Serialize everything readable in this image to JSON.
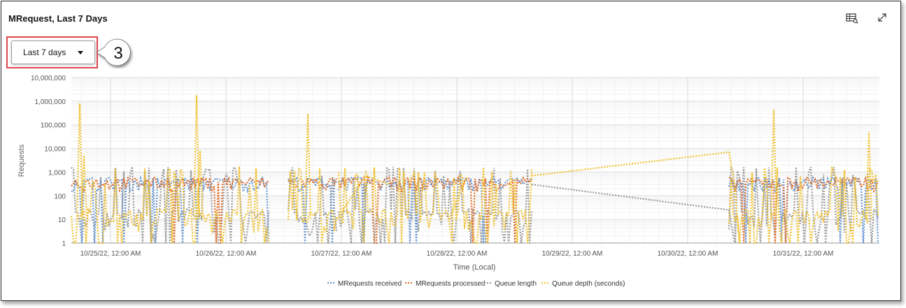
{
  "panel": {
    "title": "MRequest, Last 7 Days",
    "icons": {
      "table_view": "table-view-icon",
      "expand": "expand-icon"
    }
  },
  "range_select": {
    "value": "Last 7 days",
    "callout_number": "3"
  },
  "colors": {
    "received": "#6c98d2",
    "processed": "#e2702f",
    "queue_length": "#9b9b9b",
    "queue_depth": "#f1c232",
    "highlight": "#e0474c"
  },
  "chart_data": {
    "type": "line",
    "ylabel": "Requests",
    "xlabel": "Time (Local)",
    "y_scale": "log",
    "ylim": [
      1,
      10000000
    ],
    "y_ticks": [
      "1",
      "10",
      "100",
      "1,000",
      "10,000",
      "100,000",
      "1,000,000",
      "10,000,000"
    ],
    "x_ticks": [
      "10/25/22, 12:00 AM",
      "10/26/22, 12:00 AM",
      "10/27/22, 12:00 AM",
      "10/28/22, 12:00 AM",
      "10/29/22, 12:00 AM",
      "10/30/22, 12:00 AM",
      "10/31/22, 12:00 AM"
    ],
    "grid": true,
    "legend_position": "bottom",
    "series": [
      {
        "name": "MRequests received",
        "typical": 300,
        "notes": "dotted blue"
      },
      {
        "name": "MRequests processed",
        "typical": 300,
        "notes": "dotted orange"
      },
      {
        "name": "Queue length",
        "typical": 10,
        "notes": "dotted gray"
      },
      {
        "name": "Queue depth (seconds)",
        "typical": 10,
        "notes": "dotted yellow"
      }
    ]
  }
}
